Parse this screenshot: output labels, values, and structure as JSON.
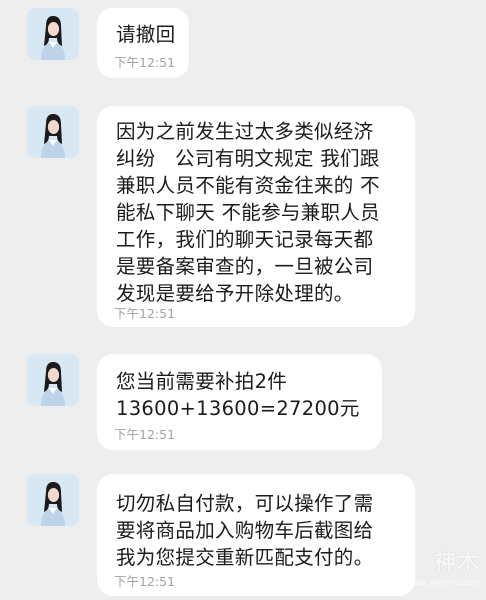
{
  "messages": [
    {
      "text": "请撤回",
      "time": "下午12:51"
    },
    {
      "text": "因为之前发生过太多类似经济\n纠纷   公司有明文规定 我们跟\n兼职人员不能有资金往来的 不\n能私下聊天 不能参与兼职人员\n工作，我们的聊天记录每天都\n是要备案审查的，一旦被公司\n发现是要给予开除处理的。",
      "time": "下午12:51"
    },
    {
      "text": "您当前需要补拍2件\n13600+13600=27200元",
      "time": "下午12:51"
    },
    {
      "text": "切勿私自付款，可以操作了需\n要将商品加入购物车后截图给\n我为您提交重新匹配支付的。",
      "time": "下午12:51"
    }
  ],
  "watermark": {
    "main": "神木",
    "sub": "hao shenmu.com"
  },
  "colors": {
    "background": "#eeeeee",
    "bubble": "#ffffff",
    "text": "#1b1b1b",
    "time": "#a3a3a3"
  },
  "icons": {
    "avatar": "woman-portrait-avatar"
  }
}
